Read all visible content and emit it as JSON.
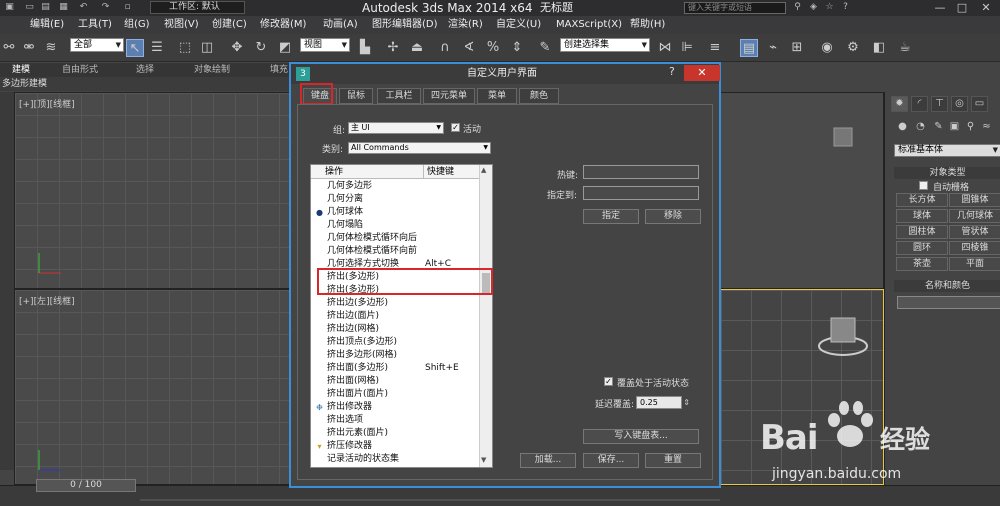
{
  "titlebar": {
    "workspace": "工作区: 默认",
    "app_title": "Autodesk 3ds Max  2014 x64",
    "doc_title": "无标题",
    "search_placeholder": "键入关键字或短语"
  },
  "menu": [
    "编辑(E)",
    "工具(T)",
    "组(G)",
    "视图(V)",
    "创建(C)",
    "修改器(M)",
    "动画(A)",
    "图形编辑器(D)",
    "渲染(R)",
    "自定义(U)",
    "MAXScript(X)",
    "帮助(H)"
  ],
  "toolbar": {
    "filter_select": "全部",
    "view_select": "视图",
    "selection_set": "创建选择集"
  },
  "ribbon": {
    "tabs": [
      "建模",
      "自由形式",
      "选择",
      "对象绘制",
      "填充"
    ],
    "sub_label": "多边形建模"
  },
  "viewports": {
    "top_left": "[+][顶][线框]",
    "bottom_left": "[+][左][线框]"
  },
  "dialog": {
    "title": "自定义用户界面",
    "help": "?",
    "close": "✕",
    "tabs": [
      "键盘",
      "鼠标",
      "工具栏",
      "四元菜单",
      "菜单",
      "颜色"
    ],
    "group_label": "组:",
    "group_value": "主 UI",
    "active_label": "活动",
    "active_checked": true,
    "category_label": "类别:",
    "category_value": "All Commands",
    "list_headers": {
      "action": "操作",
      "shortcut": "快捷键"
    },
    "rows": [
      {
        "name": "几何多边形",
        "key": "",
        "icon": ""
      },
      {
        "name": "几何分离",
        "key": "",
        "icon": ""
      },
      {
        "name": "几何球体",
        "key": "",
        "icon": "sphere"
      },
      {
        "name": "几何塌陷",
        "key": "",
        "icon": ""
      },
      {
        "name": "几何体检模式循环向后",
        "key": "",
        "icon": ""
      },
      {
        "name": "几何体检模式循环向前",
        "key": "",
        "icon": ""
      },
      {
        "name": "几何选择方式切换",
        "key": "Alt+C",
        "icon": ""
      },
      {
        "name": "挤出(多边形)",
        "key": "",
        "icon": ""
      },
      {
        "name": "挤出(多边形)",
        "key": "",
        "icon": ""
      },
      {
        "name": "挤出边(多边形)",
        "key": "",
        "icon": ""
      },
      {
        "name": "挤出边(面片)",
        "key": "",
        "icon": ""
      },
      {
        "name": "挤出边(网格)",
        "key": "",
        "icon": ""
      },
      {
        "name": "挤出顶点(多边形)",
        "key": "",
        "icon": ""
      },
      {
        "name": "挤出多边形(网格)",
        "key": "",
        "icon": ""
      },
      {
        "name": "挤出面(多边形)",
        "key": "Shift+E",
        "icon": ""
      },
      {
        "name": "挤出面(网格)",
        "key": "",
        "icon": ""
      },
      {
        "name": "挤出面片(面片)",
        "key": "",
        "icon": ""
      },
      {
        "name": "挤出修改器",
        "key": "",
        "icon": "modifier"
      },
      {
        "name": "挤出选项",
        "key": "",
        "icon": ""
      },
      {
        "name": "挤出元素(面片)",
        "key": "",
        "icon": ""
      },
      {
        "name": "挤压修改器",
        "key": "",
        "icon": "squeeze"
      },
      {
        "name": "记录活动的状态集",
        "key": "",
        "icon": ""
      }
    ],
    "hotkey_label": "热键:",
    "assigned_label": "指定到:",
    "assign_button": "指定",
    "remove_button": "移除",
    "override_label": "覆盖处于活动状态",
    "override_checked": true,
    "delay_label": "延迟覆盖:",
    "delay_value": "0.25",
    "write_button": "写入键盘表...",
    "load_button": "加载...",
    "save_button": "保存...",
    "reset_button": "重置"
  },
  "command_panel": {
    "dropdown": "标准基本体",
    "object_type_title": "对象类型",
    "autogrid_label": "自动栅格",
    "buttons": [
      "长方体",
      "圆锥体",
      "球体",
      "几何球体",
      "圆柱体",
      "管状体",
      "圆环",
      "四棱锥",
      "茶壶",
      "平面"
    ],
    "name_color_title": "名称和颜色"
  },
  "timeline": {
    "counter": "0 / 100"
  },
  "watermark": {
    "brand": "Bai",
    "brand2": "经验",
    "url": "jingyan.baidu.com"
  },
  "colors": {
    "accent_border": "#3a8fd8",
    "highlight": "#d8262b",
    "close": "#c7352d"
  }
}
